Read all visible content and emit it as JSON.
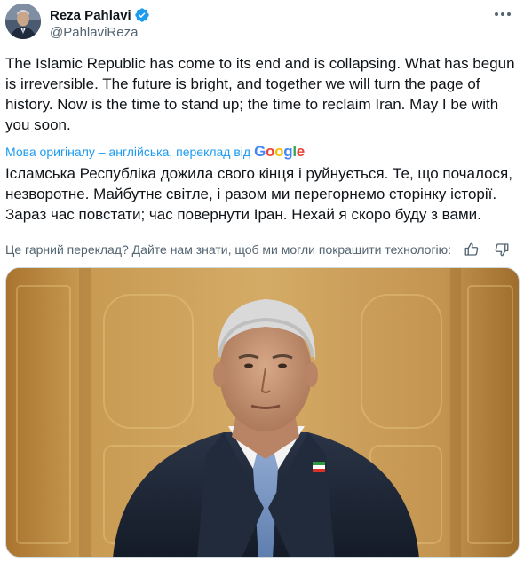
{
  "author": {
    "display_name": "Reza Pahlavi",
    "handle": "@PahlaviReza",
    "verified": true,
    "verified_color": "#1d9bf0"
  },
  "icons": {
    "verified": "verified-badge-icon",
    "more": "more-options-icon",
    "thumbs_up": "thumbs-up-icon",
    "thumbs_down": "thumbs-down-icon"
  },
  "tweet": {
    "text_original": "The Islamic Republic has come to its end and is collapsing. What has begun is irreversible. The future is bright, and together we will turn the page of history. Now is the time to stand up; the time to reclaim Iran. May I be with you soon.",
    "translation_label": "Мова оригіналу – англійська, переклад від",
    "translation_provider": "Google",
    "text_translated": "Ісламська Республіка дожила свого кінця і руйнується. Те, що почалося, незворотне. Майбутнє світле, і разом ми перегорнемо сторінку історії. Зараз час повстати; час повернути Іран. Нехай я скоро буду з вами.",
    "feedback_question": "Це гарний переклад? Дайте нам знати, щоб ми могли покращити технологію:"
  },
  "colors": {
    "text_primary": "#0f1419",
    "text_secondary": "#536471",
    "link": "#1d9bf0",
    "google_blue": "#4285f4",
    "google_red": "#ea4335",
    "google_yellow": "#fbbc05",
    "google_green": "#34a853"
  }
}
